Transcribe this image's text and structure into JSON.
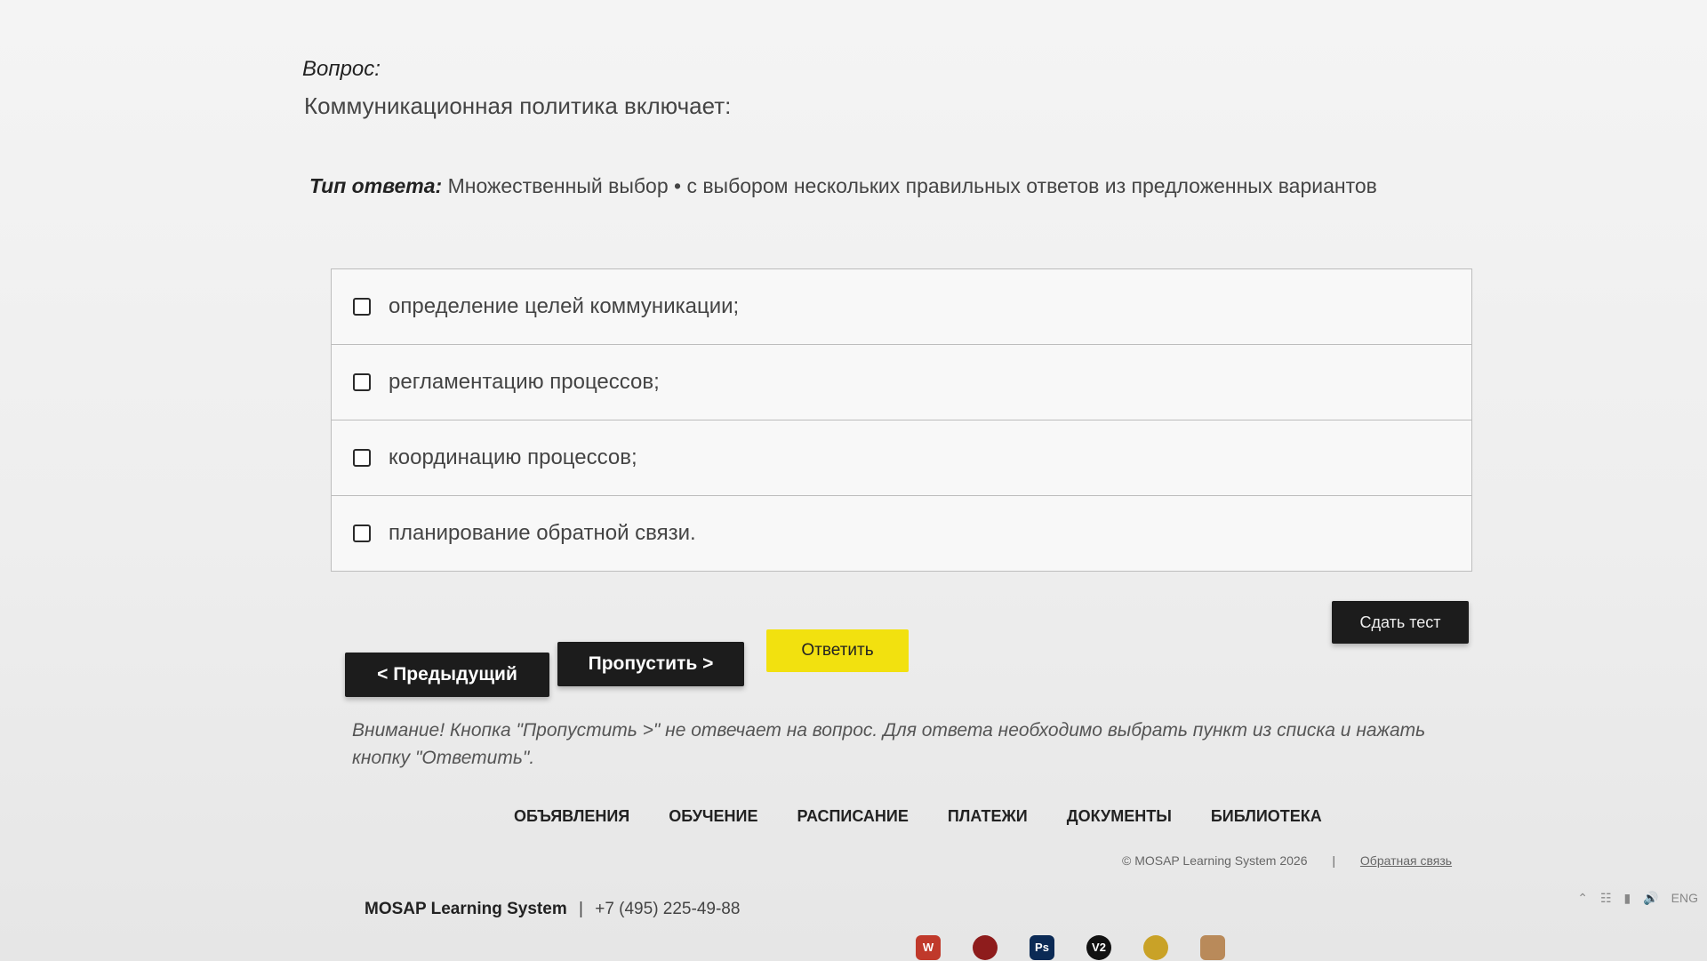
{
  "question": {
    "label": "Вопрос:",
    "text": "Коммуникационная политика включает:"
  },
  "answer_type": {
    "label": "Тип ответа:",
    "value": "Множественный выбор • с выбором нескольких правильных ответов из предложенных вариантов"
  },
  "options": [
    {
      "text": "определение целей коммуникации;",
      "checked": false
    },
    {
      "text": "регламентацию процессов;",
      "checked": false
    },
    {
      "text": "координацию процессов;",
      "checked": false
    },
    {
      "text": "планирование обратной связи.",
      "checked": false
    }
  ],
  "buttons": {
    "prev": "< Предыдущий",
    "skip": "Пропустить >",
    "answer": "Ответить",
    "submit": "Сдать тест"
  },
  "notice": "Внимание! Кнопка \"Пропустить >\" не отвечает на вопрос. Для ответа необходимо выбрать пункт из списка и нажать кнопку \"Ответить\".",
  "footer": {
    "nav": [
      "ОБЪЯВЛЕНИЯ",
      "ОБУЧЕНИЕ",
      "РАСПИСАНИЕ",
      "ПЛАТЕЖИ",
      "ДОКУМЕНТЫ",
      "БИБЛИОТЕКА"
    ],
    "copyright": "© MOSAP Learning System 2026",
    "separator": "|",
    "feedback_link": "Обратная связь",
    "brand": "MOSAP Learning System",
    "brand_separator": "|",
    "phone": "+7 (495) 225-49-88"
  },
  "taskbar": {
    "icons": [
      {
        "name": "word-icon",
        "label": "W",
        "color": "#c0392b"
      },
      {
        "name": "app-red-icon",
        "label": "",
        "color": "#8e1c1c"
      },
      {
        "name": "photoshop-icon",
        "label": "Ps",
        "color": "#0b2a55"
      },
      {
        "name": "v2-icon",
        "label": "V2",
        "color": "#111111"
      },
      {
        "name": "sun-app-icon",
        "label": "",
        "color": "#c9a227"
      },
      {
        "name": "user-app-icon",
        "label": "",
        "color": "#b98a5a"
      }
    ],
    "tray_lang": "ENG"
  },
  "colors": {
    "dark_button": "#1c1c1c",
    "answer_button": "#f2e10f"
  }
}
